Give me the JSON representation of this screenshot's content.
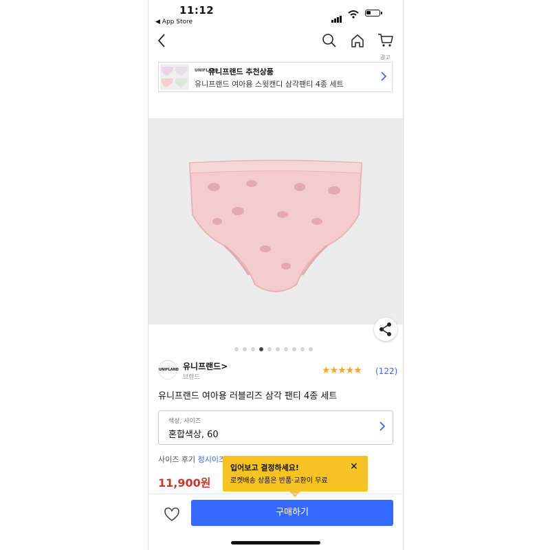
{
  "status": {
    "time": "11:12",
    "back_app": "◀ App Store"
  },
  "nav": {
    "icons": [
      "back-icon",
      "search-icon",
      "home-icon",
      "cart-icon"
    ]
  },
  "recommendation": {
    "ad_tag": "광고",
    "brand_mini": "UNIFLAND",
    "title": "유니프랜드 추천상품",
    "subtitle": "유니프랜드 여아용 스윗캔디 삼각팬티 4종 세트"
  },
  "gallery": {
    "total": 10,
    "active_index": 4
  },
  "brand": {
    "logo_text": "UNIFLAND",
    "name": "유니프랜드>",
    "sub": "브랜드"
  },
  "rating": {
    "stars": "★★★★★",
    "count": "(122)"
  },
  "product": {
    "title": "유니프랜드 여아용 러블리즈 삼각 팬티 4종 세트",
    "option_label": "색상, 사이즈",
    "option_value": "혼합색상, 60",
    "size_review_label": "사이즈 후기",
    "size_review_link": "정시이즈",
    "price": "11,900원"
  },
  "tooltip": {
    "title": "입어보고 결정하세요!",
    "subtitle": "로켓배송 상품은 반품·교환이 무료",
    "close": "✕"
  },
  "bottom": {
    "buy_label": "구매하기"
  },
  "colors": {
    "accent": "#346aff",
    "price": "#c0392b",
    "tooltip": "#f6c226",
    "star": "#f5a623",
    "product_pink": "#f4cccf"
  }
}
